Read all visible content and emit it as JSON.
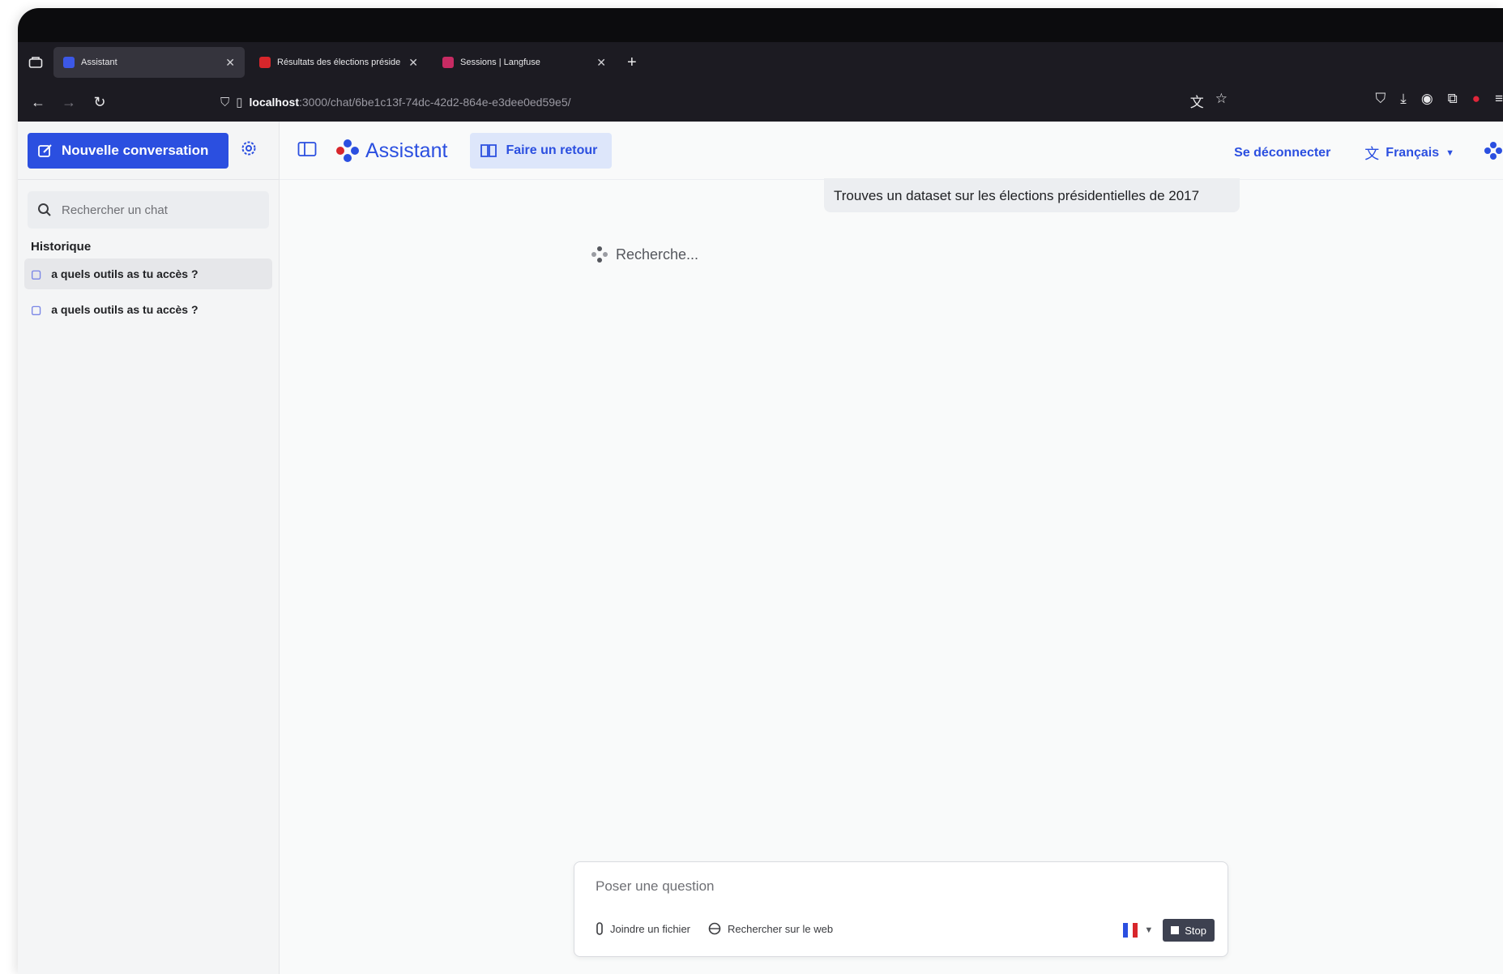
{
  "browser": {
    "tabs": [
      {
        "title": "Assistant",
        "active": true,
        "favicon_color": "#3c58e6"
      },
      {
        "title": "Résultats des élections préside",
        "active": false,
        "favicon_color": "#d8262b"
      },
      {
        "title": "Sessions | Langfuse",
        "active": false,
        "favicon_color": "#c72b63"
      }
    ],
    "url_host": "localhost",
    "url_path": ":3000/chat/6be1c13f-74dc-42d2-864e-e3dee0ed59e5/"
  },
  "sidebar": {
    "new_conversation": "Nouvelle conversation",
    "search_placeholder": "Rechercher un chat",
    "history_title": "Historique",
    "history": [
      {
        "label": "a quels outils as tu accès ?",
        "active": true
      },
      {
        "label": "a quels outils as tu accès ?",
        "active": false
      }
    ]
  },
  "header": {
    "app_name": "Assistant",
    "feedback": "Faire un retour",
    "logout": "Se déconnecter",
    "language": "Français"
  },
  "chat": {
    "user_message": "Trouves un dataset sur les élections présidentielles de 2017",
    "status": "Recherche..."
  },
  "composer": {
    "placeholder": "Poser une question",
    "attach": "Joindre un fichier",
    "web_search": "Rechercher sur le web",
    "stop": "Stop"
  },
  "colors": {
    "accent": "#2b4fe0",
    "accent_light": "#dde6fa"
  }
}
